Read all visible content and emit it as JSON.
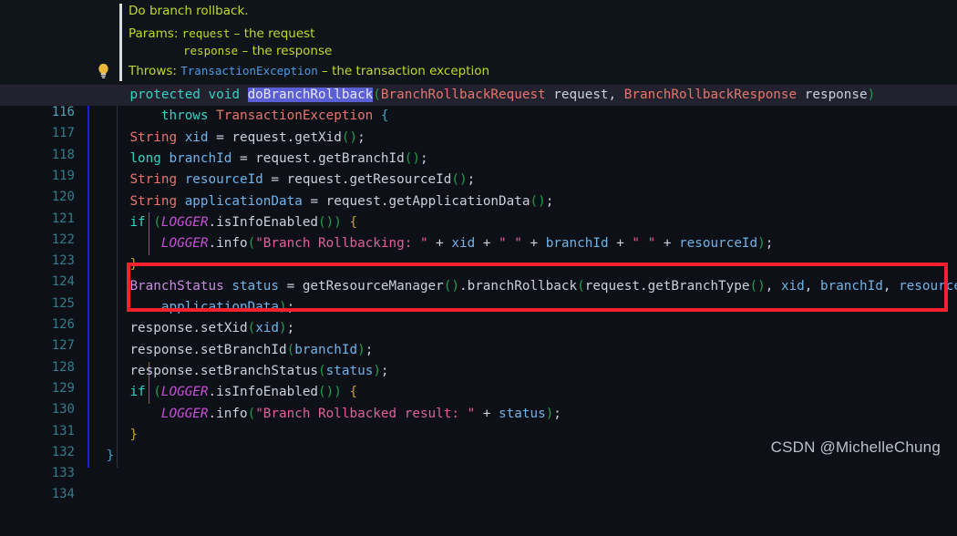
{
  "doc": {
    "icon": "lightbulb-icon",
    "summary": "Do branch rollback.",
    "params_label": "Params:",
    "params": [
      {
        "name": "request",
        "dash": " – ",
        "desc": "the request"
      },
      {
        "name": "response",
        "dash": " – ",
        "desc": "the response"
      }
    ],
    "throws_label": "Throws:",
    "throws": {
      "type": "TransactionException",
      "dash": " – ",
      "desc": "the transaction exception"
    }
  },
  "editor": {
    "current_line": 116,
    "selection_text": "doBranchRollback",
    "first_line": 116,
    "last_line": 134,
    "lines": [
      {
        "n": "116"
      },
      {
        "n": "117"
      },
      {
        "n": "118"
      },
      {
        "n": "119"
      },
      {
        "n": "120"
      },
      {
        "n": "121"
      },
      {
        "n": "122"
      },
      {
        "n": "123"
      },
      {
        "n": "124"
      },
      {
        "n": "125"
      },
      {
        "n": "126"
      },
      {
        "n": "127"
      },
      {
        "n": "128"
      },
      {
        "n": "129"
      },
      {
        "n": "130"
      },
      {
        "n": "131"
      },
      {
        "n": "132"
      },
      {
        "n": "133"
      },
      {
        "n": "134"
      }
    ],
    "code": {
      "l116": {
        "kw1": "protected",
        "kw2": "void",
        "name": "doBranchRollback",
        "p1": "(",
        "t1": "BranchRollbackRequest",
        "v1": "request",
        "comma": ",",
        "t2": "BranchRollbackResponse",
        "v2": "response",
        "p2": ")"
      },
      "l117": {
        "kw": "throws",
        "type": "TransactionException",
        "brace": "{"
      },
      "l118": {
        "type": "String",
        "var": "xid",
        "eq": "=",
        "obj": "request",
        "dot": ".",
        "m": "getXid",
        "p": "()",
        "semi": ";"
      },
      "l119": {
        "type": "long",
        "var": "branchId",
        "eq": "=",
        "obj": "request",
        "dot": ".",
        "m": "getBranchId",
        "p": "()",
        "semi": ";"
      },
      "l120": {
        "type": "String",
        "var": "resourceId",
        "eq": "=",
        "obj": "request",
        "dot": ".",
        "m": "getResourceId",
        "p": "()",
        "semi": ";"
      },
      "l121": {
        "type": "String",
        "var": "applicationData",
        "eq": "=",
        "obj": "request",
        "dot": ".",
        "m": "getApplicationData",
        "p": "()",
        "semi": ";"
      },
      "l122": {
        "kw": "if",
        "lp": "(",
        "logger": "LOGGER",
        "dot": ".",
        "m": "isInfoEnabled",
        "p": "()",
        "rp": ")",
        "brace": "{"
      },
      "l123": {
        "logger": "LOGGER",
        "dot": ".",
        "m": "info",
        "lp": "(",
        "s1": "\"Branch Rollbacking: \"",
        "plus": "+",
        "v1": "xid",
        "s2": "\" \"",
        "v2": "branchId",
        "s3": "\" \"",
        "v3": "resourceId",
        "rp": ")",
        "semi": ";"
      },
      "l124": {
        "brace": "}"
      },
      "l125": {
        "type": "BranchStatus",
        "var": "status",
        "eq": "=",
        "m1": "getResourceManager",
        "p1": "()",
        "dot": ".",
        "m2": "branchRollback",
        "lp": "(",
        "obj": "request",
        "m3": "getBranchType",
        "p2": "()",
        "c1": ",",
        "a1": "xid",
        "c2": ",",
        "a2": "branchId",
        "c3": ",",
        "a3": "resourceId",
        "c4": ","
      },
      "l126": {
        "arg": "applicationData",
        "rp": ")",
        "semi": ";"
      },
      "l127": {
        "obj": "response",
        "dot": ".",
        "m": "setXid",
        "lp": "(",
        "arg": "xid",
        "rp": ")",
        "semi": ";"
      },
      "l128": {
        "obj": "response",
        "dot": ".",
        "m": "setBranchId",
        "lp": "(",
        "arg": "branchId",
        "rp": ")",
        "semi": ";"
      },
      "l129": {
        "obj": "response",
        "dot": ".",
        "m": "setBranchStatus",
        "lp": "(",
        "arg": "status",
        "rp": ")",
        "semi": ";"
      },
      "l130": {
        "kw": "if",
        "lp": "(",
        "logger": "LOGGER",
        "dot": ".",
        "m": "isInfoEnabled",
        "p": "()",
        "rp": ")",
        "brace": "{"
      },
      "l131": {
        "logger": "LOGGER",
        "dot": ".",
        "m": "info",
        "lp": "(",
        "s1": "\"Branch Rollbacked result: \"",
        "plus": "+",
        "v1": "status",
        "rp": ")",
        "semi": ";"
      },
      "l132": {
        "brace": "}"
      },
      "l133": {
        "brace": "}"
      },
      "l134": {
        "empty": ""
      }
    }
  },
  "annotation": {
    "type": "red-highlight-box",
    "color": "#f5222d",
    "covers_lines": "125-126"
  },
  "watermark": {
    "text": "CSDN @MichelleChung"
  }
}
